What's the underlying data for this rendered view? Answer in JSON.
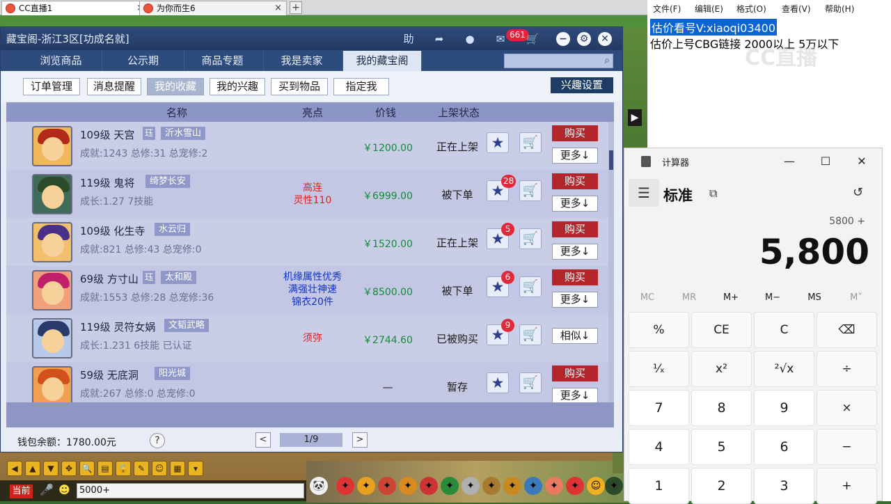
{
  "browser": {
    "tabs": [
      {
        "title": "CC直播1",
        "close": "×"
      },
      {
        "title": "为你而生6",
        "close": "×"
      }
    ],
    "new_tab": "+"
  },
  "cbg": {
    "title": "藏宝阁-浙江3区[功成名就]",
    "toolbar": {
      "help": "助",
      "share": "➦",
      "record": "●",
      "message": "✉",
      "message_count": "661",
      "cart": "🛒",
      "minimize": "−",
      "settings": "⚙",
      "close": "✕"
    },
    "nav": [
      "浏览商品",
      "公示期",
      "商品专题",
      "我是卖家",
      "我的藏宝阁"
    ],
    "nav_active": 4,
    "sub_nav": [
      "订单管理",
      "消息提醒",
      "我的收藏",
      "我的兴趣",
      "买到物品",
      "指定我"
    ],
    "sub_active": 2,
    "interest_settings": "兴趣设置",
    "columns": [
      "名称",
      "亮点",
      "价钱",
      "上架状态"
    ],
    "items": [
      {
        "level": "109级",
        "school": "天宫",
        "tag": "珏",
        "server": "沂水雪山",
        "stats": "成就:1243 总修:31 总宠修:2",
        "highlights": [],
        "highlight_color": "",
        "price": "￥1200.00",
        "status": "正在上架",
        "fav_count": "",
        "action": "购买",
        "more": "更多↓"
      },
      {
        "level": "119级",
        "school": "鬼将",
        "tag": "",
        "server": "绮梦长安",
        "stats": "成长:1.27 7技能",
        "highlights": [
          "高连",
          "灵性110"
        ],
        "highlight_color": "red",
        "price": "￥6999.00",
        "status": "被下单",
        "fav_count": "28",
        "action": "购买",
        "more": "更多↓"
      },
      {
        "level": "109级",
        "school": "化生寺",
        "tag": "",
        "server": "水云归",
        "stats": "成就:821 总修:43 总宠修:0",
        "highlights": [],
        "highlight_color": "",
        "price": "￥1520.00",
        "status": "正在上架",
        "fav_count": "5",
        "action": "购买",
        "more": "更多↓"
      },
      {
        "level": "69级",
        "school": "方寸山",
        "tag": "珏",
        "server": "太和殿",
        "stats": "成就:1553 总修:28 总宠修:36",
        "highlights": [
          "机缘属性优秀",
          "满强壮神速",
          "锦衣20件"
        ],
        "highlight_color": "blue",
        "price": "￥8500.00",
        "status": "被下单",
        "fav_count": "6",
        "action": "购买",
        "more": "更多↓"
      },
      {
        "level": "119级",
        "school": "灵符女娲",
        "tag": "",
        "server": "文韬武略",
        "stats": "成长:1.231 6技能 已认证",
        "highlights": [
          "须弥"
        ],
        "highlight_color": "red",
        "price": "￥2744.60",
        "status": "已被购买",
        "fav_count": "9",
        "action": "",
        "more": "相似↓"
      },
      {
        "level": "59级",
        "school": "无底洞",
        "tag": "",
        "server": "阳光城",
        "stats": "成就:267 总修:0 总宠修:0",
        "highlights": [],
        "highlight_color": "",
        "price": "—",
        "status": "暂存",
        "fav_count": "",
        "action": "购买",
        "more": "更多↓"
      }
    ],
    "wallet": "钱包余额：1780.00元",
    "help": "?",
    "page": "1/9",
    "prev": "<",
    "next": ">"
  },
  "game": {
    "chat_channel": "当前",
    "chat_input": "5000+",
    "toolbar_icons": [
      "◀",
      "▲",
      "▼",
      "✥",
      "🔍",
      "▤",
      "🔒",
      "✎",
      "☺",
      "▦",
      "▾"
    ]
  },
  "notepad": {
    "menu": [
      "文件(F)",
      "编辑(E)",
      "格式(O)",
      "查看(V)",
      "帮助(H)"
    ],
    "line1": "估价看号V:xiaoqi03400",
    "line2": "估价上号CBG链接 2000以上 5万以下",
    "watermark": "CC直播"
  },
  "calculator": {
    "title": "计算器",
    "mode": "标准",
    "expression": "5800 +",
    "display": "5,800",
    "memory": [
      "MC",
      "MR",
      "M+",
      "M−",
      "MS",
      "M˅"
    ],
    "memory_disabled": [
      true,
      true,
      false,
      false,
      false,
      true
    ],
    "keys": [
      [
        "%",
        "CE",
        "C",
        "⌫"
      ],
      [
        "¹⁄ₓ",
        "x²",
        "²√x",
        "÷"
      ],
      [
        "7",
        "8",
        "9",
        "×"
      ],
      [
        "4",
        "5",
        "6",
        "−"
      ],
      [
        "1",
        "2",
        "3",
        "+"
      ]
    ],
    "window": {
      "minimize": "—",
      "maximize": "☐",
      "close": "✕"
    }
  },
  "colors": {
    "accent_red": "#b3262c",
    "price_green": "#138a3a",
    "nav_blue": "#2e4b7d",
    "highlight_blue": "#1232c8"
  }
}
